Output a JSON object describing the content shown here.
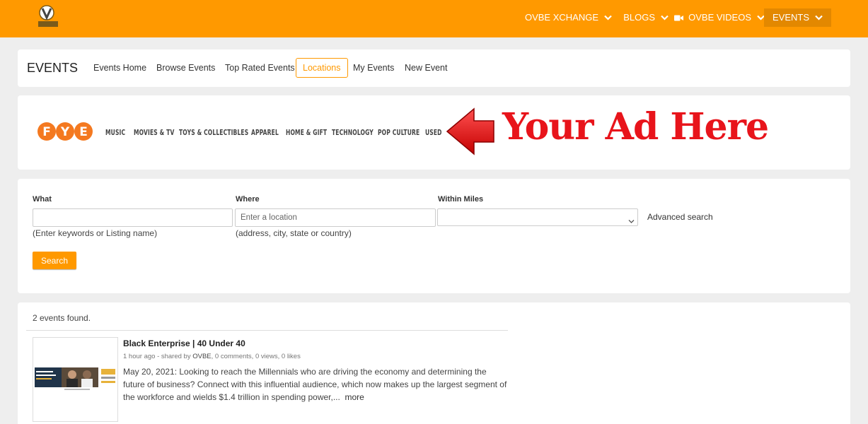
{
  "brand": {
    "logo_text": "OVBE",
    "accent_color": "#ff9900"
  },
  "nav": {
    "items": [
      {
        "label": "OVBE XCHANGE",
        "icon": "chevron-down-icon"
      },
      {
        "label": "BLOGS",
        "icon": "chevron-down-icon"
      },
      {
        "label": "OVBE VIDEOS",
        "icon": "chevron-down-icon",
        "leading_icon": "video-camera-icon"
      },
      {
        "label": "EVENTS",
        "icon": "chevron-down-icon",
        "active": true
      }
    ]
  },
  "events_header": {
    "title": "EVENTS",
    "tabs": [
      "Events Home",
      "Browse Events",
      "Top Rated Events",
      "Locations",
      "My Events",
      "New Event"
    ],
    "active_tab": "Locations"
  },
  "ad": {
    "brand": "FYE",
    "menu": [
      "MUSIC",
      "MOVIES & TV",
      "TOYS & COLLECTIBLES",
      "APPAREL",
      "HOME & GIFT",
      "TECHNOLOGY",
      "POP CULTURE",
      "USED"
    ],
    "headline": "Your Ad Here",
    "headline_color": "#e8141b"
  },
  "search": {
    "what_label": "What",
    "what_value": "",
    "what_hint": "(Enter keywords or Listing name)",
    "where_label": "Where",
    "where_placeholder": "Enter a location",
    "where_hint": "(address, city, state or country)",
    "miles_label": "Within Miles",
    "miles_value": "",
    "advanced_label": "Advanced search",
    "button_label": "Search"
  },
  "results": {
    "count_text": "2 events found.",
    "events": [
      {
        "title": "Black Enterprise | 40 Under 40",
        "meta_prefix": "1 hour ago - shared by ",
        "meta_author": "OVBE",
        "meta_suffix": ", 0 comments, 0 views, 0 likes",
        "description": "May 20, 2021: Looking to reach the Millennials who are driving the economy and determining the future of business? Connect with this influential audience, which now makes up the largest segment of the workforce and wields $1.4 trillion in spending power,...",
        "more_label": "more"
      }
    ]
  }
}
